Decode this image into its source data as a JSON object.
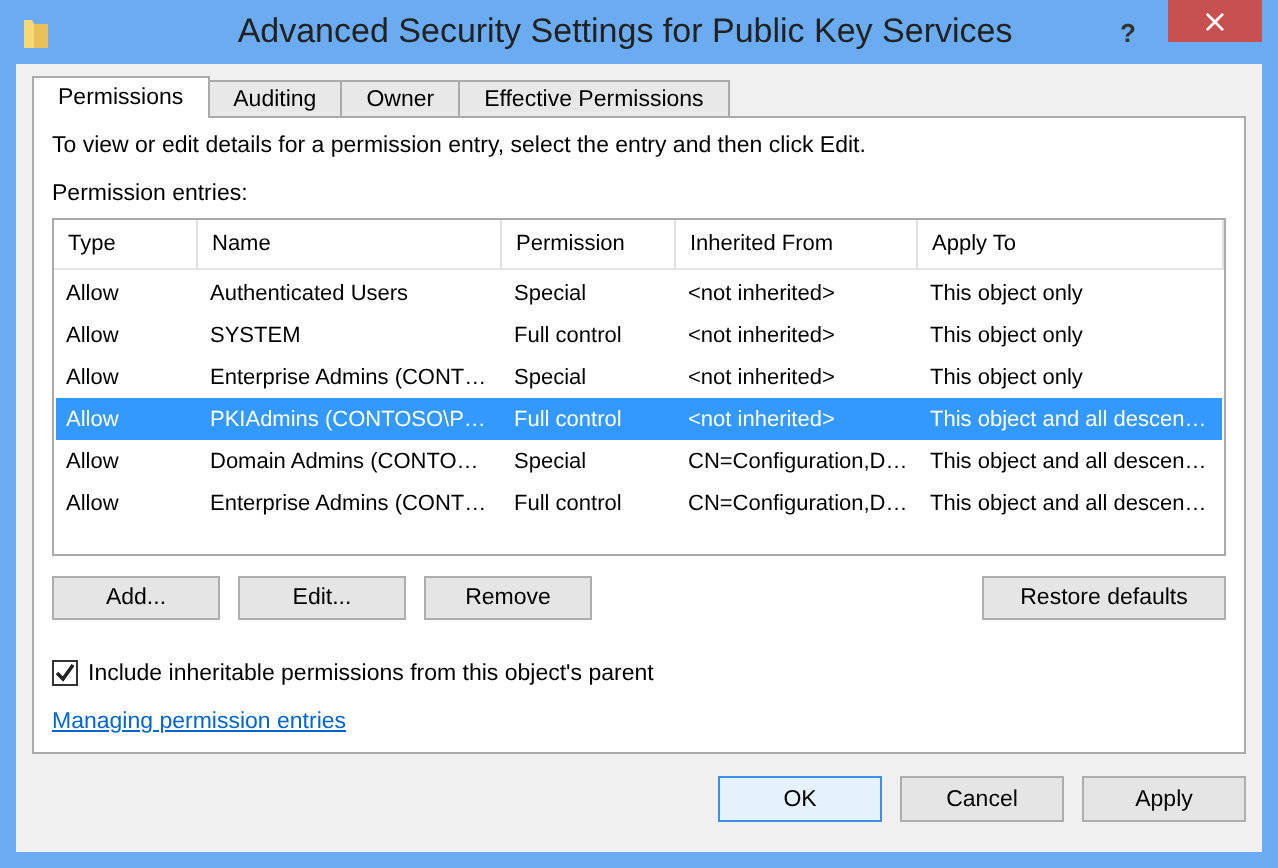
{
  "window": {
    "title": "Advanced Security Settings for Public Key Services",
    "help": "?",
    "close": "×"
  },
  "tabs": [
    {
      "label": "Permissions",
      "selected": true
    },
    {
      "label": "Auditing",
      "selected": false
    },
    {
      "label": "Owner",
      "selected": false
    },
    {
      "label": "Effective Permissions",
      "selected": false
    }
  ],
  "instructions": "To view or edit details for a permission entry, select the entry and then click Edit.",
  "entries_label": "Permission entries:",
  "table": {
    "columns": [
      "Type",
      "Name",
      "Permission",
      "Inherited From",
      "Apply To"
    ],
    "rows": [
      {
        "cells": [
          "Allow",
          "Authenticated Users",
          "Special",
          "<not inherited>",
          "This object only"
        ],
        "selected": false
      },
      {
        "cells": [
          "Allow",
          "SYSTEM",
          "Full control",
          "<not inherited>",
          "This object only"
        ],
        "selected": false
      },
      {
        "cells": [
          "Allow",
          "Enterprise Admins (CONT…",
          "Special",
          "<not inherited>",
          "This object only"
        ],
        "selected": false
      },
      {
        "cells": [
          "Allow",
          "PKIAdmins (CONTOSO\\P…",
          "Full control",
          "<not inherited>",
          "This object and all descen…"
        ],
        "selected": true
      },
      {
        "cells": [
          "Allow",
          "Domain Admins (CONTO…",
          "Special",
          "CN=Configuration,D…",
          "This object and all descen…"
        ],
        "selected": false
      },
      {
        "cells": [
          "Allow",
          "Enterprise Admins (CONT…",
          "Full control",
          "CN=Configuration,D…",
          "This object and all descen…"
        ],
        "selected": false
      }
    ]
  },
  "entry_buttons": [
    "Add...",
    "Edit...",
    "Remove"
  ],
  "restore_button": "Restore defaults",
  "inherit_checkbox": {
    "label": "Include inheritable permissions from this object's parent",
    "checked": true
  },
  "help_link": "Managing permission entries",
  "dialog_buttons": [
    {
      "label": "OK",
      "default": true
    },
    {
      "label": "Cancel",
      "default": false
    },
    {
      "label": "Apply",
      "default": false
    }
  ]
}
